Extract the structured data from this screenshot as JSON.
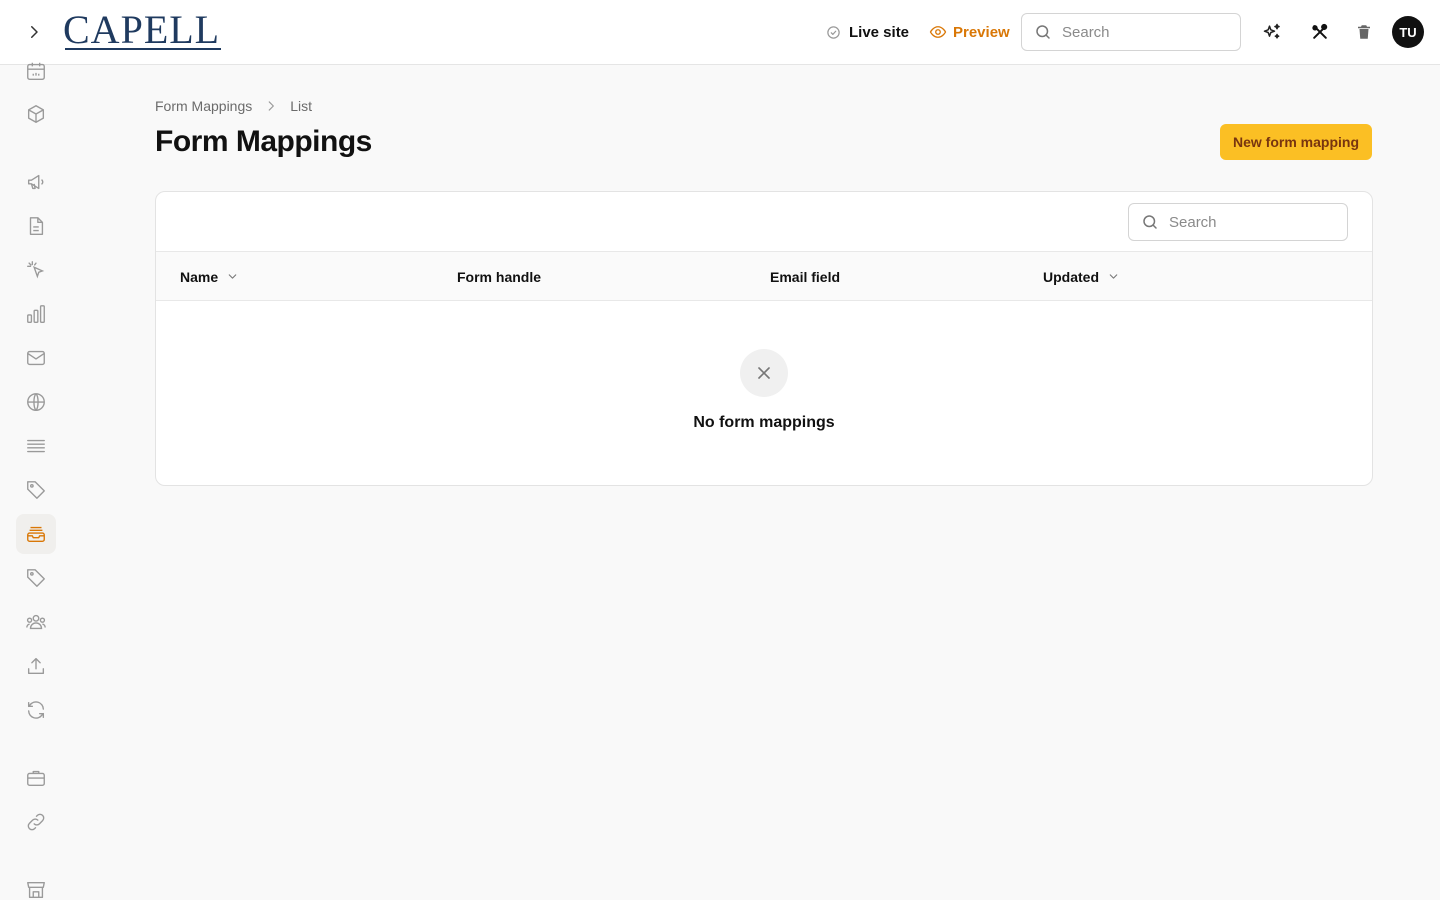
{
  "header": {
    "logo_text": "CAPELL",
    "live_site_label": "Live site",
    "preview_label": "Preview",
    "search_placeholder": "Search",
    "avatar_initials": "TU"
  },
  "sidebar": {
    "items": [
      {
        "icon": "calendar-icon"
      },
      {
        "icon": "cube-icon"
      },
      {
        "icon": "megaphone-icon"
      },
      {
        "icon": "document-icon"
      },
      {
        "icon": "cursor-click-icon"
      },
      {
        "icon": "bar-chart-icon"
      },
      {
        "icon": "mail-icon"
      },
      {
        "icon": "globe-icon"
      },
      {
        "icon": "list-icon"
      },
      {
        "icon": "tag-icon"
      },
      {
        "icon": "inbox-stack-icon",
        "active": true
      },
      {
        "icon": "tag-icon"
      },
      {
        "icon": "users-icon"
      },
      {
        "icon": "upload-icon"
      },
      {
        "icon": "refresh-icon"
      },
      {
        "icon": "briefcase-icon"
      },
      {
        "icon": "link-icon"
      },
      {
        "icon": "store-icon"
      }
    ]
  },
  "breadcrumb": {
    "parent": "Form Mappings",
    "current": "List"
  },
  "page": {
    "title": "Form Mappings",
    "new_button_label": "New form mapping"
  },
  "table": {
    "search_placeholder": "Search",
    "columns": [
      {
        "label": "Name",
        "sortable": true
      },
      {
        "label": "Form handle",
        "sortable": false
      },
      {
        "label": "Email field",
        "sortable": false
      },
      {
        "label": "Updated",
        "sortable": true
      }
    ],
    "rows": [],
    "empty_text": "No form mappings"
  },
  "colors": {
    "accent": "#fbbf24",
    "accent_text": "#78350f",
    "preview": "#d97706",
    "logo": "#1f3a5f"
  }
}
